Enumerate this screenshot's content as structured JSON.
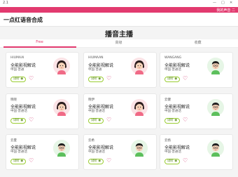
{
  "window": {
    "title": "2.1",
    "controls": [
      "—",
      "□",
      "✕"
    ]
  },
  "topbar": {
    "right_text": "我的声音  二"
  },
  "header": {
    "brand": "一点红语音合成"
  },
  "page": {
    "title": "播音主播"
  },
  "tabs": [
    {
      "label": "Free"
    },
    {
      "label": "高级"
    },
    {
      "label": "收藏"
    }
  ],
  "cards": [
    {
      "name": "HIUMAAI",
      "title": "全能影视解说",
      "location": "中国·普通",
      "button": "试听",
      "gender": "female",
      "row": 0,
      "col": 0
    },
    {
      "name": "HIUMAAN",
      "title": "全能影视解说",
      "location": "中国·普通",
      "button": "试听",
      "gender": "female",
      "row": 0,
      "col": 1
    },
    {
      "name": "WANGANG",
      "title": "全能影视解说",
      "location": "中国·普通话",
      "button": "试听",
      "gender": "male",
      "row": 0,
      "col": 2
    },
    {
      "name": "晓晓",
      "title": "全能影视解说",
      "location": "中国·普通话",
      "button": "试听",
      "gender": "female",
      "row": 1,
      "col": 0
    },
    {
      "name": "晓伊",
      "title": "全能影视解说",
      "location": "中国·普通话",
      "button": "试听",
      "gender": "female",
      "row": 1,
      "col": 1
    },
    {
      "name": "云健",
      "title": "全能影视解说",
      "location": "中国·普通话",
      "button": "试听",
      "gender": "male",
      "row": 1,
      "col": 2
    },
    {
      "name": "云夏",
      "title": "全能影视解说",
      "location": "中国·普通话",
      "button": "试听",
      "gender": "male",
      "row": 2,
      "col": 0
    },
    {
      "name": "云希",
      "title": "全能影视解说",
      "location": "中国·普通话",
      "button": "试听",
      "gender": "male",
      "row": 2,
      "col": 1
    },
    {
      "name": "云扬",
      "title": "全能影视解说",
      "location": "中国·普通话",
      "button": "试听",
      "gender": "male",
      "row": 2,
      "col": 2
    }
  ],
  "colors": {
    "accent": "#e23a6f",
    "button_border": "#9acd32",
    "heart": "#d0306b"
  }
}
